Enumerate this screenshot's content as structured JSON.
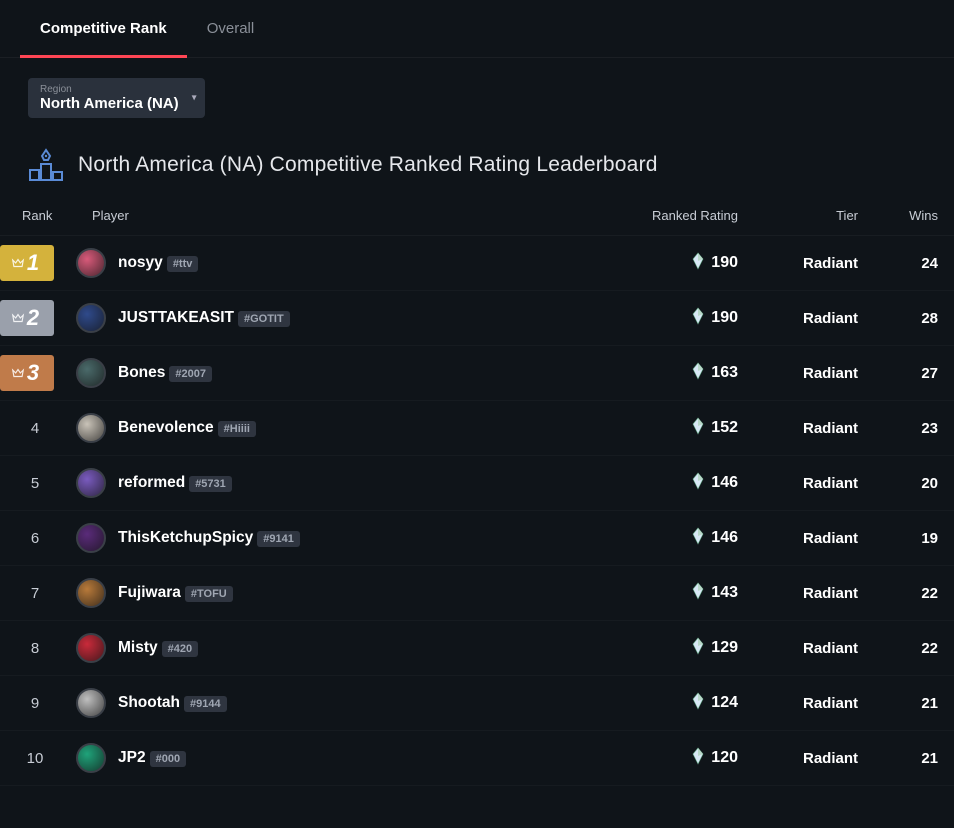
{
  "tabs": {
    "competitive": "Competitive Rank",
    "overall": "Overall"
  },
  "region": {
    "label": "Region",
    "value": "North America (NA)"
  },
  "title": "North America (NA) Competitive Ranked Rating Leaderboard",
  "columns": {
    "rank": "Rank",
    "player": "Player",
    "rating": "Ranked Rating",
    "tier": "Tier",
    "wins": "Wins"
  },
  "rows": [
    {
      "rank": 1,
      "badge": "gold",
      "avatar_color": "#d85a7a",
      "name": "nosyy",
      "tag": "#ttv",
      "rating": 190,
      "tier": "Radiant",
      "wins": 24
    },
    {
      "rank": 2,
      "badge": "silver",
      "avatar_color": "#2f4a8b",
      "name": "JUSTTAKEASIT",
      "tag": "#GOTIT",
      "rating": 190,
      "tier": "Radiant",
      "wins": 28
    },
    {
      "rank": 3,
      "badge": "bronze",
      "avatar_color": "#4a6a6a",
      "name": "Bones",
      "tag": "#2007",
      "rating": 163,
      "tier": "Radiant",
      "wins": 27
    },
    {
      "rank": 4,
      "badge": null,
      "avatar_color": "#c9c3b8",
      "name": "Benevolence",
      "tag": "#Hiiii",
      "rating": 152,
      "tier": "Radiant",
      "wins": 23
    },
    {
      "rank": 5,
      "badge": null,
      "avatar_color": "#7a5bbf",
      "name": "reformed",
      "tag": "#5731",
      "rating": 146,
      "tier": "Radiant",
      "wins": 20
    },
    {
      "rank": 6,
      "badge": null,
      "avatar_color": "#5a2b7a",
      "name": "ThisKetchupSpicy",
      "tag": "#9141",
      "rating": 146,
      "tier": "Radiant",
      "wins": 19
    },
    {
      "rank": 7,
      "badge": null,
      "avatar_color": "#b87a3a",
      "name": "Fujiwara",
      "tag": "#TOFU",
      "rating": 143,
      "tier": "Radiant",
      "wins": 22
    },
    {
      "rank": 8,
      "badge": null,
      "avatar_color": "#c92a3a",
      "name": "Misty",
      "tag": "#420",
      "rating": 129,
      "tier": "Radiant",
      "wins": 22
    },
    {
      "rank": 9,
      "badge": null,
      "avatar_color": "#bfbfbf",
      "name": "Shootah",
      "tag": "#9144",
      "rating": 124,
      "tier": "Radiant",
      "wins": 21
    },
    {
      "rank": 10,
      "badge": null,
      "avatar_color": "#1fa37a",
      "name": "JP2",
      "tag": "#000",
      "rating": 120,
      "tier": "Radiant",
      "wins": 21
    }
  ]
}
